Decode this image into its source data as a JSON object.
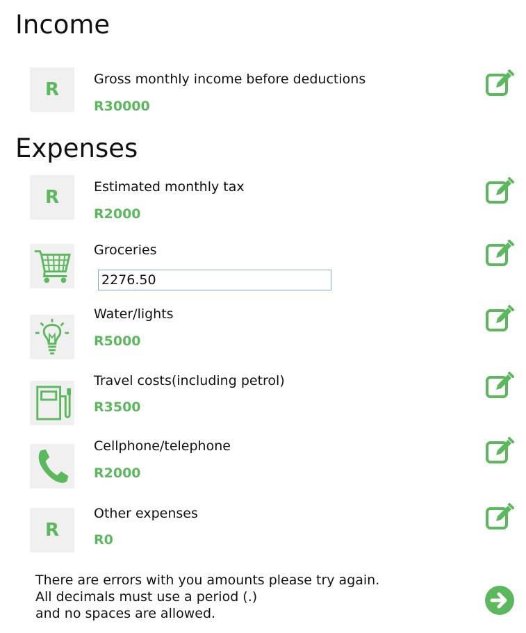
{
  "income": {
    "heading": "Income",
    "items": [
      {
        "icon": "rand-icon",
        "icon_text": "R",
        "label": "Gross monthly income before deductions",
        "amount": "R30000"
      }
    ]
  },
  "expenses": {
    "heading": "Expenses",
    "items": [
      {
        "icon": "rand-icon",
        "icon_text": "R",
        "label": "Estimated monthly tax",
        "amount": "R2000"
      },
      {
        "icon": "shopping-cart-icon",
        "label": "Groceries",
        "input_value": "2276.50"
      },
      {
        "icon": "light-bulb-icon",
        "label": "Water/lights",
        "amount": "R5000"
      },
      {
        "icon": "fuel-pump-icon",
        "label": "Travel costs(including petrol)",
        "amount": "R3500"
      },
      {
        "icon": "telephone-icon",
        "label": "Cellphone/telephone",
        "amount": "R2000"
      },
      {
        "icon": "rand-icon",
        "icon_text": "R",
        "label": "Other expenses",
        "amount": "R0"
      }
    ]
  },
  "error_message": {
    "lines": [
      "There are errors with you amounts please try again.",
      "All decimals must use a period (.)",
      "and no spaces are allowed."
    ]
  },
  "colors": {
    "accent": "#5cb85c",
    "tile_bg": "#f0f0f0",
    "input_border": "#7aa7d6"
  }
}
